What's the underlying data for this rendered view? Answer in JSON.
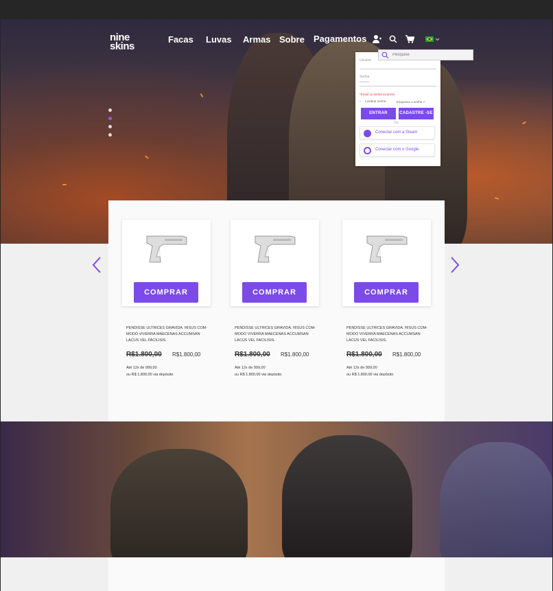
{
  "brand": {
    "line1": "nine",
    "line2": "skins"
  },
  "nav": {
    "links": [
      "Facas",
      "Luvas",
      "Armas",
      "Sobre",
      "Pagamentos"
    ],
    "icons": [
      "user-icon",
      "search-icon",
      "cart-icon",
      "brazil-flag-icon"
    ]
  },
  "search": {
    "placeholder": "Pesquise"
  },
  "login": {
    "user_label": "Usuário",
    "pass_label": "Senha",
    "pass_mask": "••••••••",
    "error": "*Email ou senha incorreto",
    "remember": "Lembrar senha",
    "forgot": "Esqueceu a senha ?",
    "login_button": "ENTRAR",
    "signup_button": "CADASTRE -SE",
    "or": "Ou",
    "steam": "Conectar com a Steam",
    "google": "Conectar com o Google"
  },
  "carousel": {
    "slides": 4,
    "active_index": 1
  },
  "products": [
    {
      "button": "COMPRAR",
      "desc1": "PENDISSE ULTRICES GRAVIDA. RISUS COM-",
      "desc2": "MODO VIVERRA MAECENAS ACCUMSAN",
      "desc3": "LACUS VEL FACILISIS.",
      "old_price": "R$1.800,00",
      "new_price": "R$1.800,00",
      "installments": "Até 12x de 999,00",
      "deposit": "ou R$ 1.800,00 via depósito"
    },
    {
      "button": "COMPRAR",
      "desc1": "PENDISSE ULTRICES GRAVIDA. RISUS COM-",
      "desc2": "MODO VIVERRA MAECENAS ACCUMSAN",
      "desc3": "LACUS VEL FACILISIS.",
      "old_price": "R$1.800,00",
      "new_price": "R$1.800,00",
      "installments": "Até 12x de 999,00",
      "deposit": "ou R$ 1.800,00 via depósito"
    },
    {
      "button": "COMPRAR",
      "desc1": "PENDISSE ULTRICES GRAVIDA. RISUS COM-",
      "desc2": "MODO VIVERRA MAECENAS ACCUMSAN",
      "desc3": "LACUS VEL FACILISIS.",
      "old_price": "R$1.800,00",
      "new_price": "R$1.800,00",
      "installments": "Até 12x de 999,00",
      "deposit": "ou R$ 1.800,00 via depósito"
    }
  ],
  "colors": {
    "accent": "#7b4be8",
    "error": "#e0383a",
    "background": "#f0f0f0"
  }
}
